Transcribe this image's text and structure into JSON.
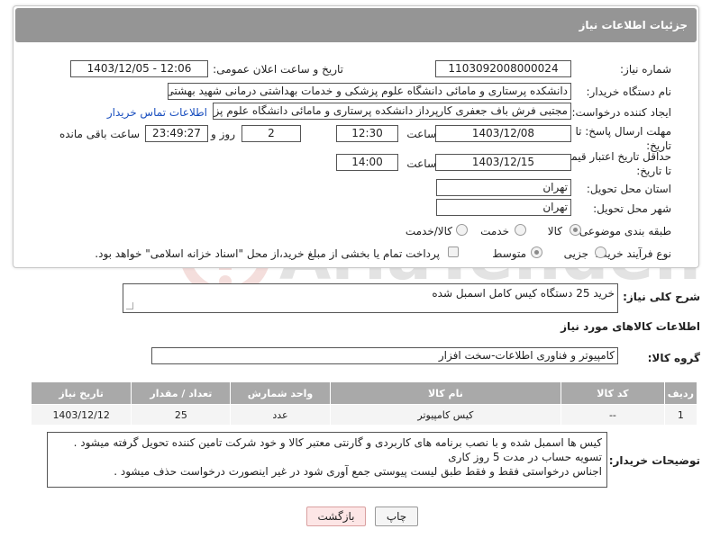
{
  "header": {
    "title": "جزئیات اطلاعات نیاز"
  },
  "fields": {
    "need_number_label": "شماره نیاز:",
    "need_number": "1103092008000024",
    "announce_label": "تاریخ و ساعت اعلان عمومی:",
    "announce_value": "1403/12/05 - 12:06",
    "buyer_org_label": "نام دستگاه خریدار:",
    "buyer_org": "دانشکده پرستاری و مامائی دانشگاه علوم پزشکی و خدمات بهداشتی درمانی شهید بهشتی",
    "creator_label": "ایجاد کننده درخواست:",
    "creator": "مجتبی فرش باف جعفری کارپرداز دانشکده پرستاری و مامائی دانشگاه علوم پزشکی",
    "contact_link": "اطلاعات تماس خریدار",
    "reply_deadline_label": "مهلت ارسال پاسخ: تا تاریخ:",
    "reply_date": "1403/12/08",
    "time_label": "ساعت",
    "reply_time": "12:30",
    "days_value": "2",
    "days_label": "روز و",
    "remaining_time": "23:49:27",
    "remaining_label": "ساعت باقی مانده",
    "validity_label": "حداقل تاریخ اعتبار قیمت: تا تاریخ:",
    "validity_date": "1403/12/15",
    "validity_time": "14:00",
    "province_label": "استان محل تحویل:",
    "province": "تهران",
    "city_label": "شهر محل تحویل:",
    "city": "تهران",
    "category_label": "طبقه بندی موضوعی:",
    "category_options": [
      "کالا",
      "خدمت",
      "کالا/خدمت"
    ],
    "process_label": "نوع فرآیند خرید :",
    "process_options": [
      "جزیی",
      "متوسط"
    ],
    "payment_note": "پرداخت تمام یا بخشی از مبلغ خرید،از محل \"اسناد خزانه اسلامی\" خواهد بود."
  },
  "summary": {
    "label": "شرح کلی نیاز:",
    "value": "خرید 25 دستگاه کیس کامل اسمبل شده"
  },
  "goods": {
    "section_title": "اطلاعات کالاهای مورد نیاز",
    "group_label": "گروه کالا:",
    "group_value": "کامپیوتر و فناوری اطلاعات-سخت افزار",
    "columns": [
      "ردیف",
      "کد کالا",
      "نام کالا",
      "واحد شمارش",
      "تعداد / مقدار",
      "تاریخ نیاز"
    ],
    "rows": [
      [
        "1",
        "--",
        "کیس کامپیوتر",
        "عدد",
        "25",
        "1403/12/12"
      ]
    ]
  },
  "buyer_notes": {
    "label": "توضیحات خریدار:",
    "lines": [
      "کیس ها اسمبل شده و با نصب برنامه های کاربردی و گارنتی معتبر کالا و خود شرکت تامین کننده تحویل گرفته میشود .",
      "تسویه حساب در مدت 5 روز کاری",
      "اجناس درخواستی فقط و فقط طبق لیست پیوستی جمع آوری شود در غیر اینصورت درخواست حذف میشود ."
    ]
  },
  "buttons": {
    "print": "چاپ",
    "back": "بازگشت"
  },
  "watermark": {
    "text": "AriaTender.net"
  }
}
